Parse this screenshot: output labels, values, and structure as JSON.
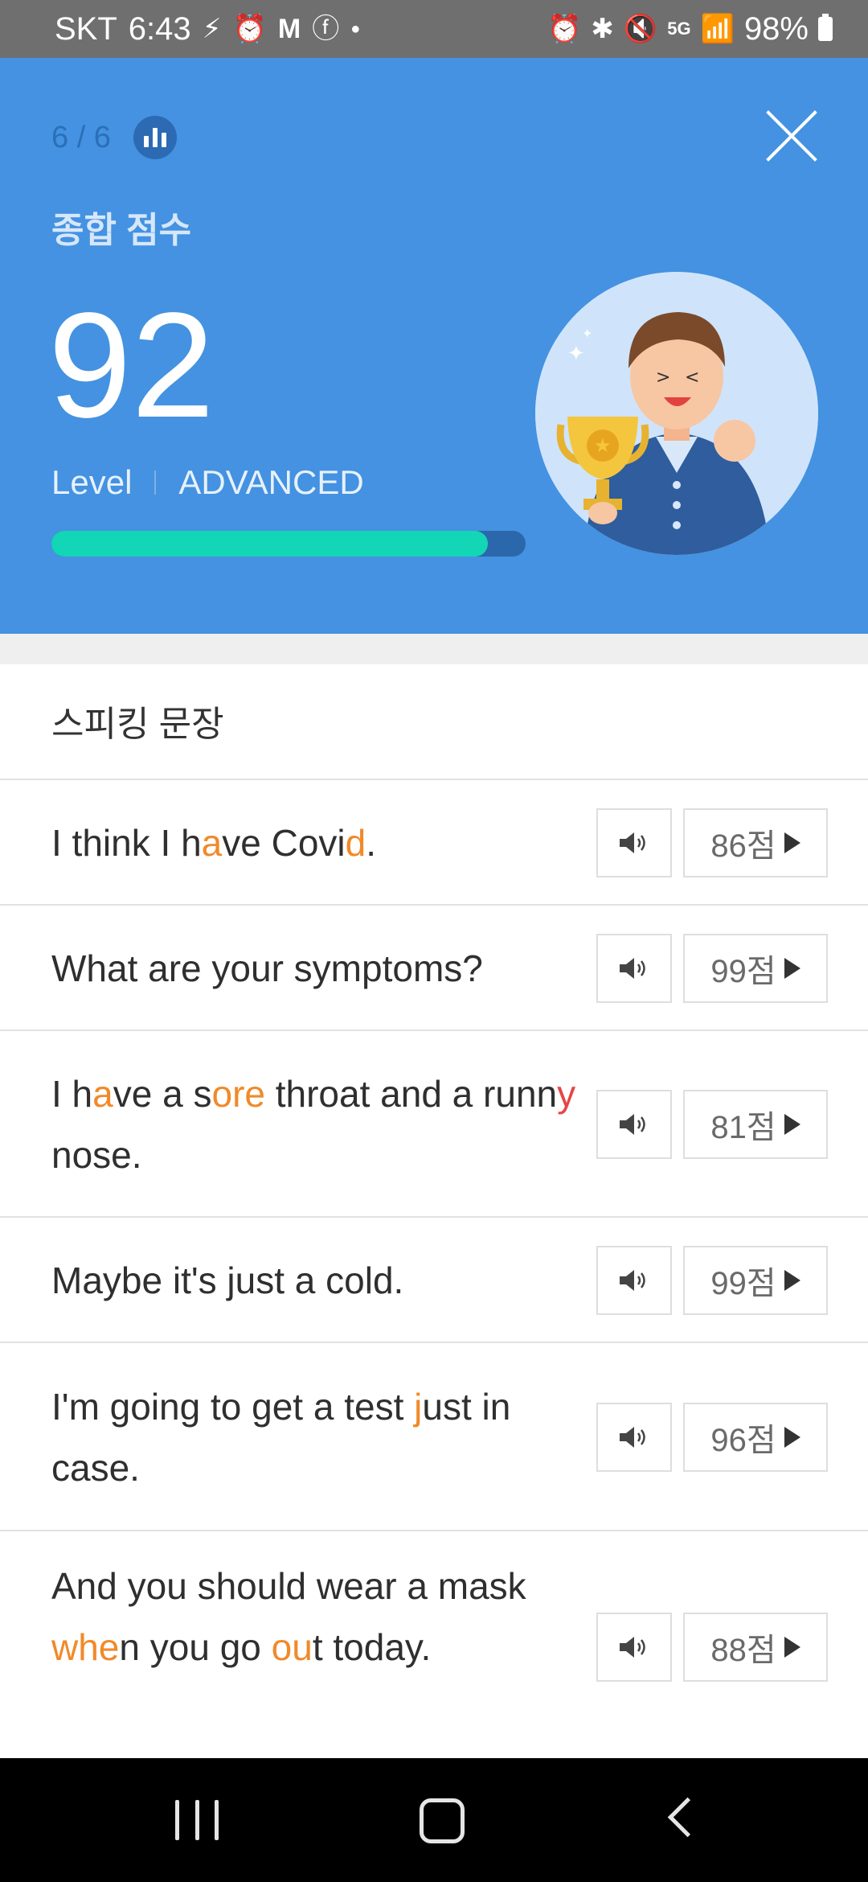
{
  "status_bar": {
    "carrier": "SKT",
    "time": "6:43",
    "battery": "98%",
    "left_icons": [
      "flash-off-icon",
      "alarm-icon",
      "gmail-icon",
      "facebook-icon",
      "dot-icon"
    ],
    "right_icons": [
      "alarm-icon",
      "bluetooth-icon",
      "mute-icon",
      "5g-icon",
      "signal-icon",
      "battery-icon"
    ]
  },
  "header": {
    "progress": "6 / 6",
    "score_label": "종합 점수",
    "score": "92",
    "level_label": "Level",
    "level_value": "ADVANCED",
    "level_progress_fraction": 0.92,
    "background_color": "#4492e1",
    "bar_color": "#12d6b6"
  },
  "section": {
    "title": "스피킹 문장"
  },
  "sentences": [
    {
      "segments": [
        {
          "t": "I think I h"
        },
        {
          "t": "a",
          "c": "o"
        },
        {
          "t": "ve Covi"
        },
        {
          "t": "d",
          "c": "o"
        },
        {
          "t": "."
        }
      ],
      "score": "86점"
    },
    {
      "segments": [
        {
          "t": "What are your symptoms?"
        }
      ],
      "score": "99점"
    },
    {
      "segments": [
        {
          "t": "I h"
        },
        {
          "t": "a",
          "c": "o"
        },
        {
          "t": "ve a s"
        },
        {
          "t": "ore",
          "c": "o"
        },
        {
          "t": " throat and a runn"
        },
        {
          "t": "y",
          "c": "r"
        },
        {
          "t": " nose."
        }
      ],
      "score": "81점"
    },
    {
      "segments": [
        {
          "t": "Maybe it's just a cold."
        }
      ],
      "score": "99점"
    },
    {
      "segments": [
        {
          "t": "I'm going to get a test "
        },
        {
          "t": "j",
          "c": "o"
        },
        {
          "t": "ust in case."
        }
      ],
      "score": "96점"
    },
    {
      "segments": [
        {
          "t": "And you should wear a mask "
        },
        {
          "t": "whe",
          "c": "o"
        },
        {
          "t": "n you go "
        },
        {
          "t": "ou",
          "c": "o"
        },
        {
          "t": "t today."
        }
      ],
      "score": "88점"
    }
  ],
  "navbar": {
    "icons": [
      "recent-apps-icon",
      "home-icon",
      "back-icon"
    ]
  }
}
